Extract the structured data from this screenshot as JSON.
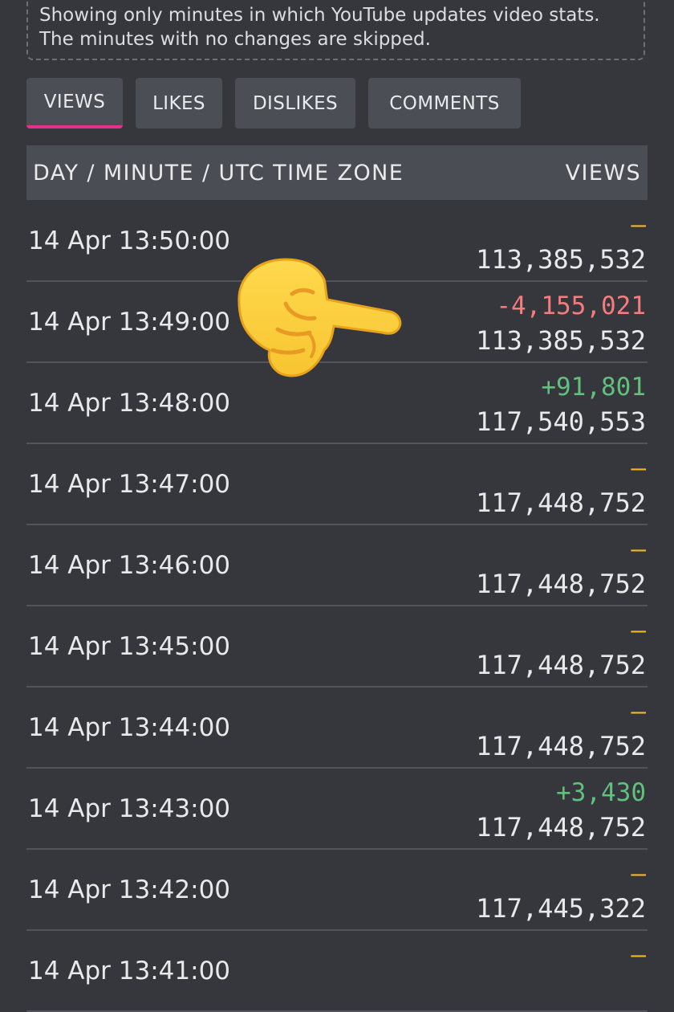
{
  "notice": {
    "text": "Showing only minutes in which YouTube updates video stats. The minutes with no changes are skipped."
  },
  "tabs": [
    {
      "label": "VIEWS",
      "active": true
    },
    {
      "label": "LIKES",
      "active": false
    },
    {
      "label": "DISLIKES",
      "active": false
    },
    {
      "label": "COMMENTS",
      "active": false
    }
  ],
  "table": {
    "header_time": "DAY / MINUTE / UTC TIME ZONE",
    "header_value": "VIEWS",
    "rows": [
      {
        "time": "14 Apr 13:50:00",
        "change": "—",
        "change_type": "none",
        "total": "113,385,532"
      },
      {
        "time": "14 Apr 13:49:00",
        "change": "-4,155,021",
        "change_type": "negative",
        "total": "113,385,532"
      },
      {
        "time": "14 Apr 13:48:00",
        "change": "+91,801",
        "change_type": "positive",
        "total": "117,540,553"
      },
      {
        "time": "14 Apr 13:47:00",
        "change": "—",
        "change_type": "none",
        "total": "117,448,752"
      },
      {
        "time": "14 Apr 13:46:00",
        "change": "—",
        "change_type": "none",
        "total": "117,448,752"
      },
      {
        "time": "14 Apr 13:45:00",
        "change": "—",
        "change_type": "none",
        "total": "117,448,752"
      },
      {
        "time": "14 Apr 13:44:00",
        "change": "—",
        "change_type": "none",
        "total": "117,448,752"
      },
      {
        "time": "14 Apr 13:43:00",
        "change": "+3,430",
        "change_type": "positive",
        "total": "117,448,752"
      },
      {
        "time": "14 Apr 13:42:00",
        "change": "—",
        "change_type": "none",
        "total": "117,445,322"
      },
      {
        "time": "14 Apr 13:41:00",
        "change": "—",
        "change_type": "none",
        "total": ""
      }
    ]
  },
  "colors": {
    "background": "#35373c",
    "tab_background": "#4b4e54",
    "active_tab_underline": "#e0318c",
    "no_change": "#f2b824",
    "negative": "#f47c7c",
    "positive": "#61c07c"
  },
  "overlay": {
    "emoji": "pointing-hand-emoji"
  }
}
